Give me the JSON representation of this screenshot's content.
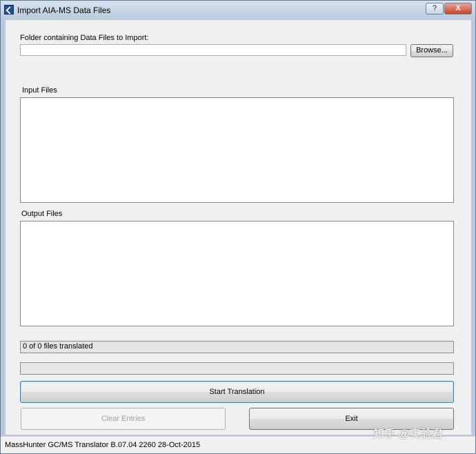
{
  "window": {
    "title": "Import AIA-MS Data Files",
    "help_glyph": "?",
    "close_glyph": "X"
  },
  "folder": {
    "label": "Folder containing Data Files to Import:",
    "value": "",
    "browse_label": "Browse..."
  },
  "input_files": {
    "label": "Input Files",
    "items": []
  },
  "output_files": {
    "label": "Output Files",
    "items": []
  },
  "status": {
    "text": "0 of 0 files translated",
    "progress_fraction": 0
  },
  "buttons": {
    "start_label": "Start Translation",
    "clear_label": "Clear Entries",
    "exit_label": "Exit"
  },
  "statusbar": {
    "text": "MassHunter GC/MS Translator B.07.04 2260 28-Oct-2015"
  },
  "watermark": {
    "text": "知乎 @实验君"
  }
}
